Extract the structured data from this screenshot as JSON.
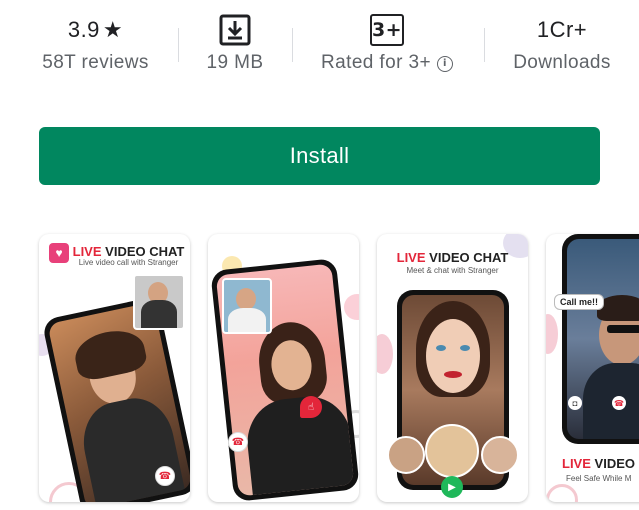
{
  "stats": {
    "rating": {
      "value": "3.9",
      "star": "★",
      "label": "58T reviews"
    },
    "size": {
      "icon": "download-icon",
      "label": "19 MB"
    },
    "content_rating": {
      "badge": "3+",
      "label": "Rated for 3+",
      "icon": "info-icon"
    },
    "downloads": {
      "value": "1Cr+",
      "label": "Downloads"
    }
  },
  "install": {
    "label": "Install",
    "color": "#01875f"
  },
  "screenshots": [
    {
      "title_red": "LIVE",
      "title_dark": "VIDEO CHAT",
      "subtitle": "Live video call with Stranger"
    },
    {},
    {
      "title_red": "LIVE",
      "title_dark": "VIDEO CHAT",
      "subtitle": "Meet & chat with Stranger"
    },
    {
      "bubble": "Call me!!",
      "title_red": "LIVE",
      "title_dark": "VIDEO",
      "subtitle": "Feel Safe While M"
    }
  ],
  "colors": {
    "accent_red": "#e3263a",
    "install_green": "#01875f",
    "text_secondary": "#5f6368"
  }
}
